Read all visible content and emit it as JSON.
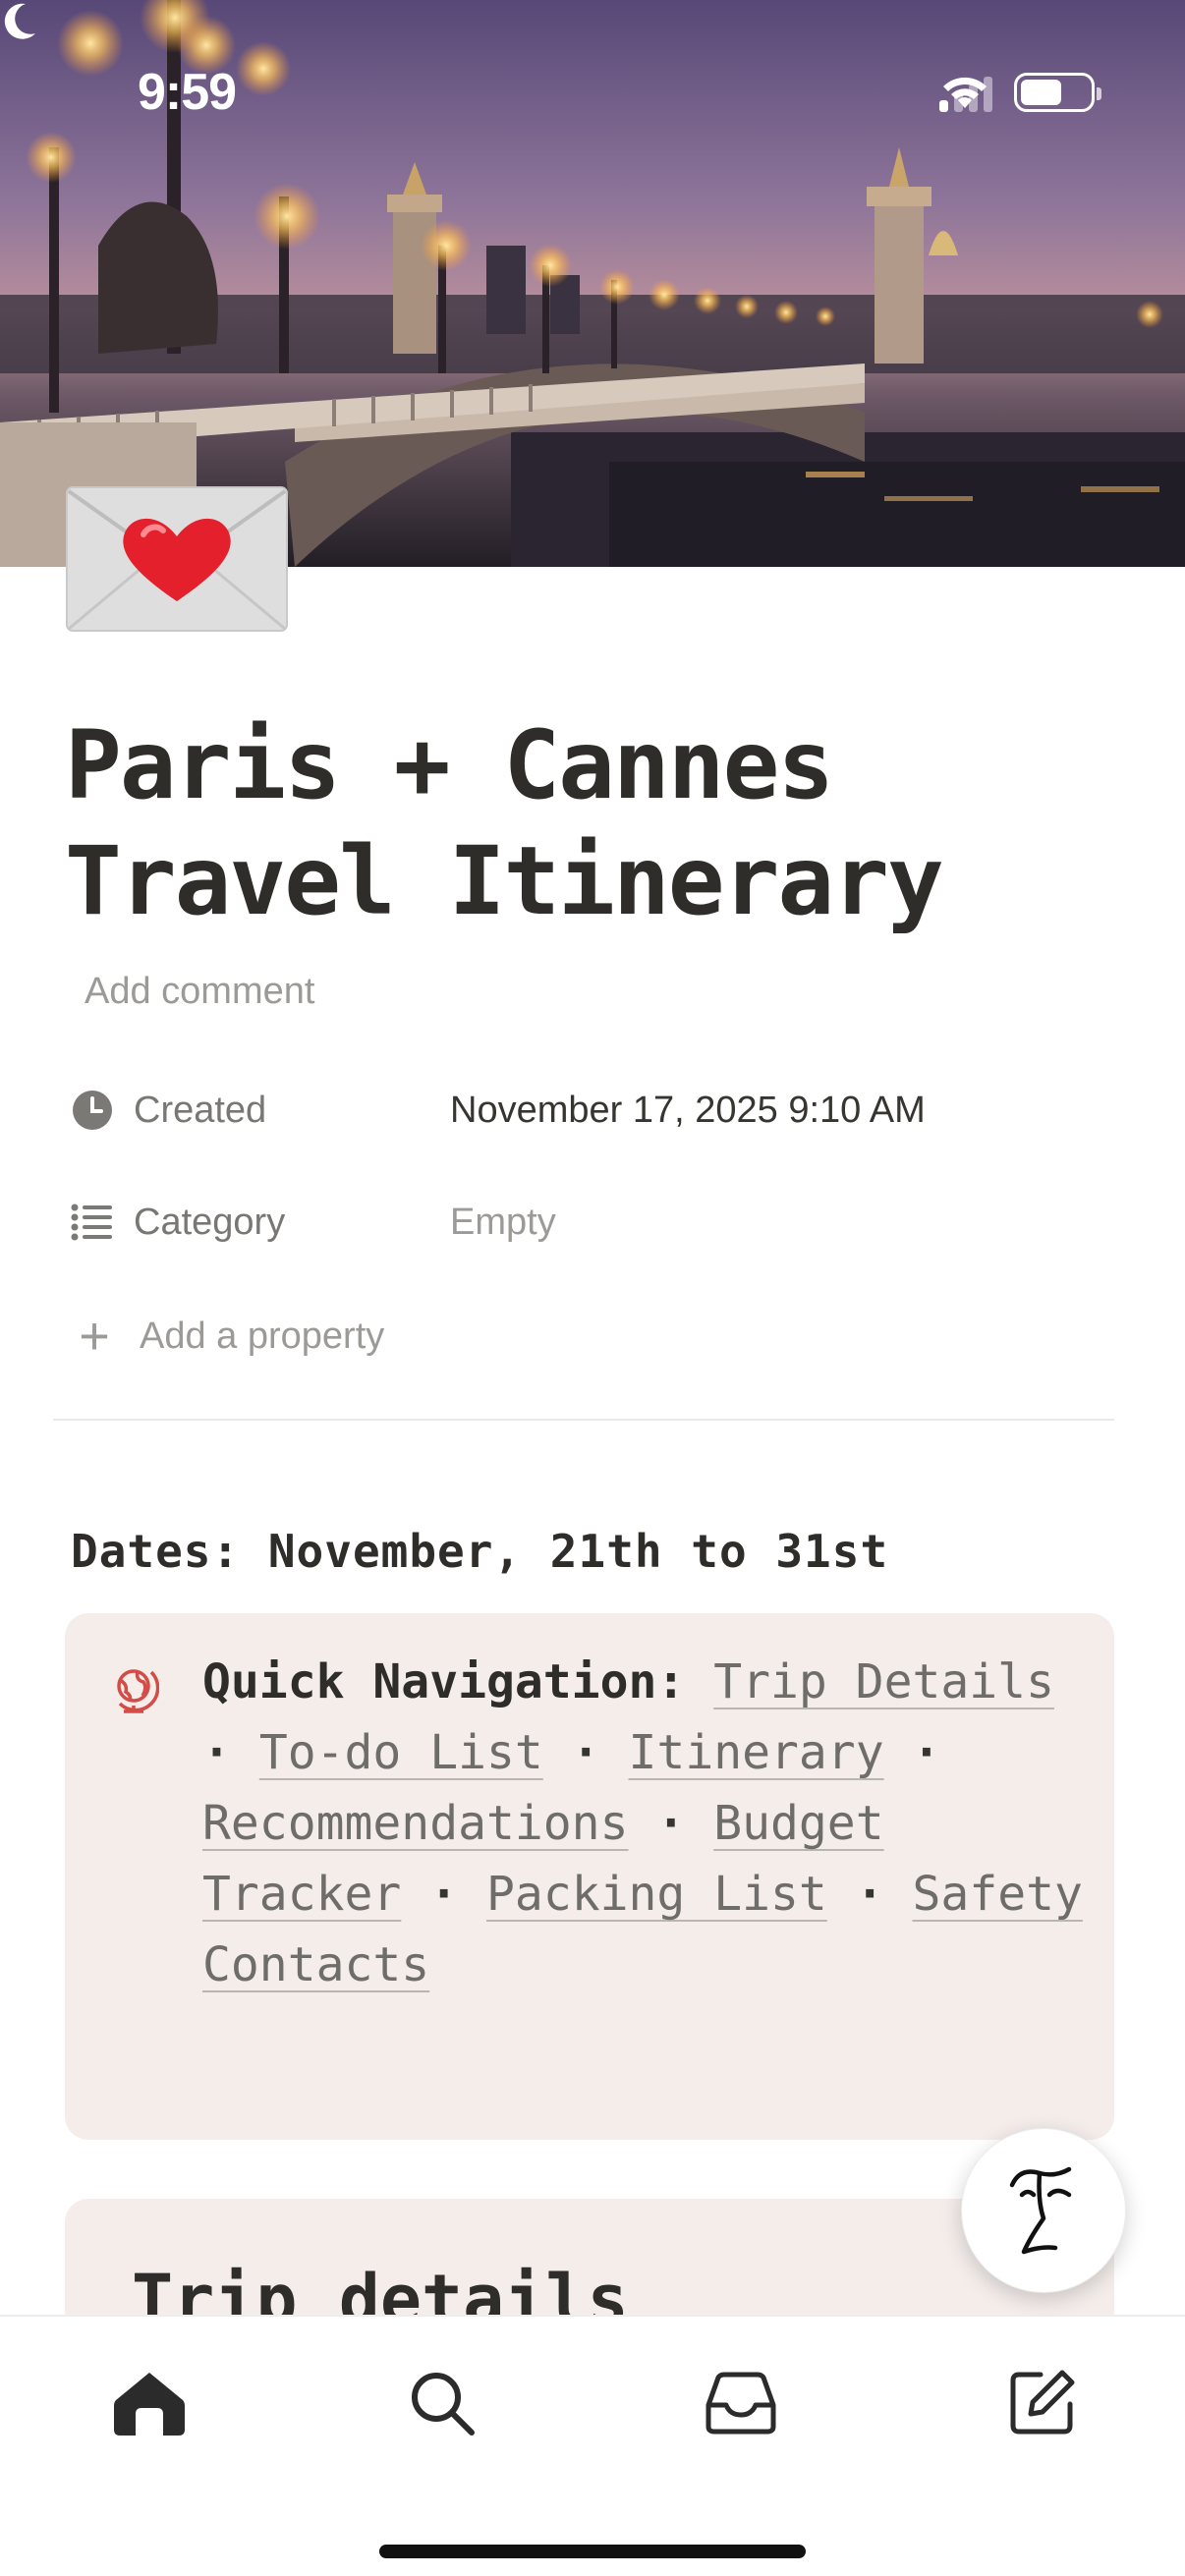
{
  "status_bar": {
    "time": "9:59"
  },
  "page": {
    "icon": "love-letter-icon",
    "title": "Paris + Cannes Travel Itinerary",
    "add_comment": "Add comment"
  },
  "properties": [
    {
      "icon": "clock-icon",
      "name": "Created",
      "value": "November 17, 2025 9:10 AM"
    },
    {
      "icon": "list-icon",
      "name": "Category",
      "value": "Empty"
    }
  ],
  "add_property": "Add a property",
  "content": {
    "dates_heading": "Dates: November, 21th to 31st",
    "callout": {
      "icon": "globe-icon",
      "label": "Quick Navigation:",
      "links": [
        "Trip Details",
        "To-do List",
        "Itinerary",
        "Recommendations",
        "Budget Tracker",
        "Packing List",
        "Safety Contacts"
      ],
      "separator": "·"
    },
    "section_heading": "Trip details"
  },
  "fab": {
    "icon": "notion-ai-face-icon"
  },
  "bottom_nav": [
    {
      "icon": "home-icon",
      "active": true
    },
    {
      "icon": "search-icon",
      "active": false
    },
    {
      "icon": "inbox-icon",
      "active": false
    },
    {
      "icon": "compose-icon",
      "active": false
    }
  ],
  "colors": {
    "accent_globe": "#d44c47",
    "callout_bg": "#f4edea",
    "text": "#37352f",
    "muted": "#9b9a97"
  }
}
